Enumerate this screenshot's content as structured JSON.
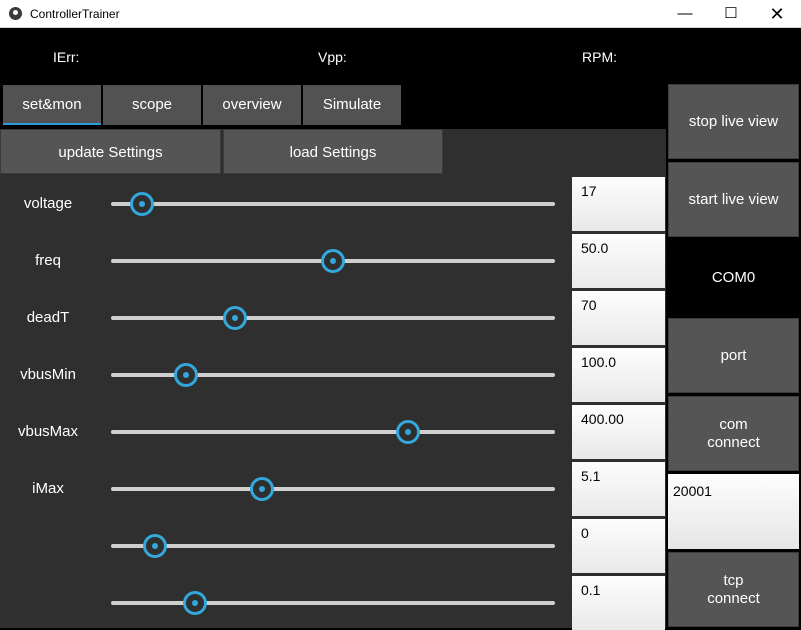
{
  "window": {
    "title": "ControllerTrainer",
    "minimize_glyph": "—",
    "maximize_glyph": "☐",
    "close_glyph": "✕"
  },
  "status": {
    "ierr_label": "IErr:",
    "vpp_label": "Vpp:",
    "rpm_label": "RPM:"
  },
  "tabs": [
    {
      "label": "set&mon",
      "active": true
    },
    {
      "label": "scope",
      "active": false
    },
    {
      "label": "overview",
      "active": false
    },
    {
      "label": "Simulate",
      "active": false
    }
  ],
  "actions": {
    "update_label": "update Settings",
    "load_label": "load Settings"
  },
  "sliders": [
    {
      "label": "voltage",
      "value": "17",
      "fraction": 0.07
    },
    {
      "label": "freq",
      "value": "50.0",
      "fraction": 0.5
    },
    {
      "label": "deadT",
      "value": "70",
      "fraction": 0.28
    },
    {
      "label": "vbusMin",
      "value": "100.0",
      "fraction": 0.17
    },
    {
      "label": "vbusMax",
      "value": "400.00",
      "fraction": 0.67
    },
    {
      "label": "iMax",
      "value": "5.1",
      "fraction": 0.34
    },
    {
      "label": "",
      "value": "0",
      "fraction": 0.1
    },
    {
      "label": "",
      "value": "0.1",
      "fraction": 0.19
    }
  ],
  "side": {
    "stop_label": "stop live view",
    "start_label": "start live view",
    "com_port": "COM0",
    "port_label": "port",
    "com_connect_label": "com\nconnect",
    "tcp_port_value": "20001",
    "tcp_connect_label": "tcp\nconnect"
  },
  "colors": {
    "accent": "#33a8dd",
    "panel": "#2f2f2f",
    "button": "#555555"
  }
}
